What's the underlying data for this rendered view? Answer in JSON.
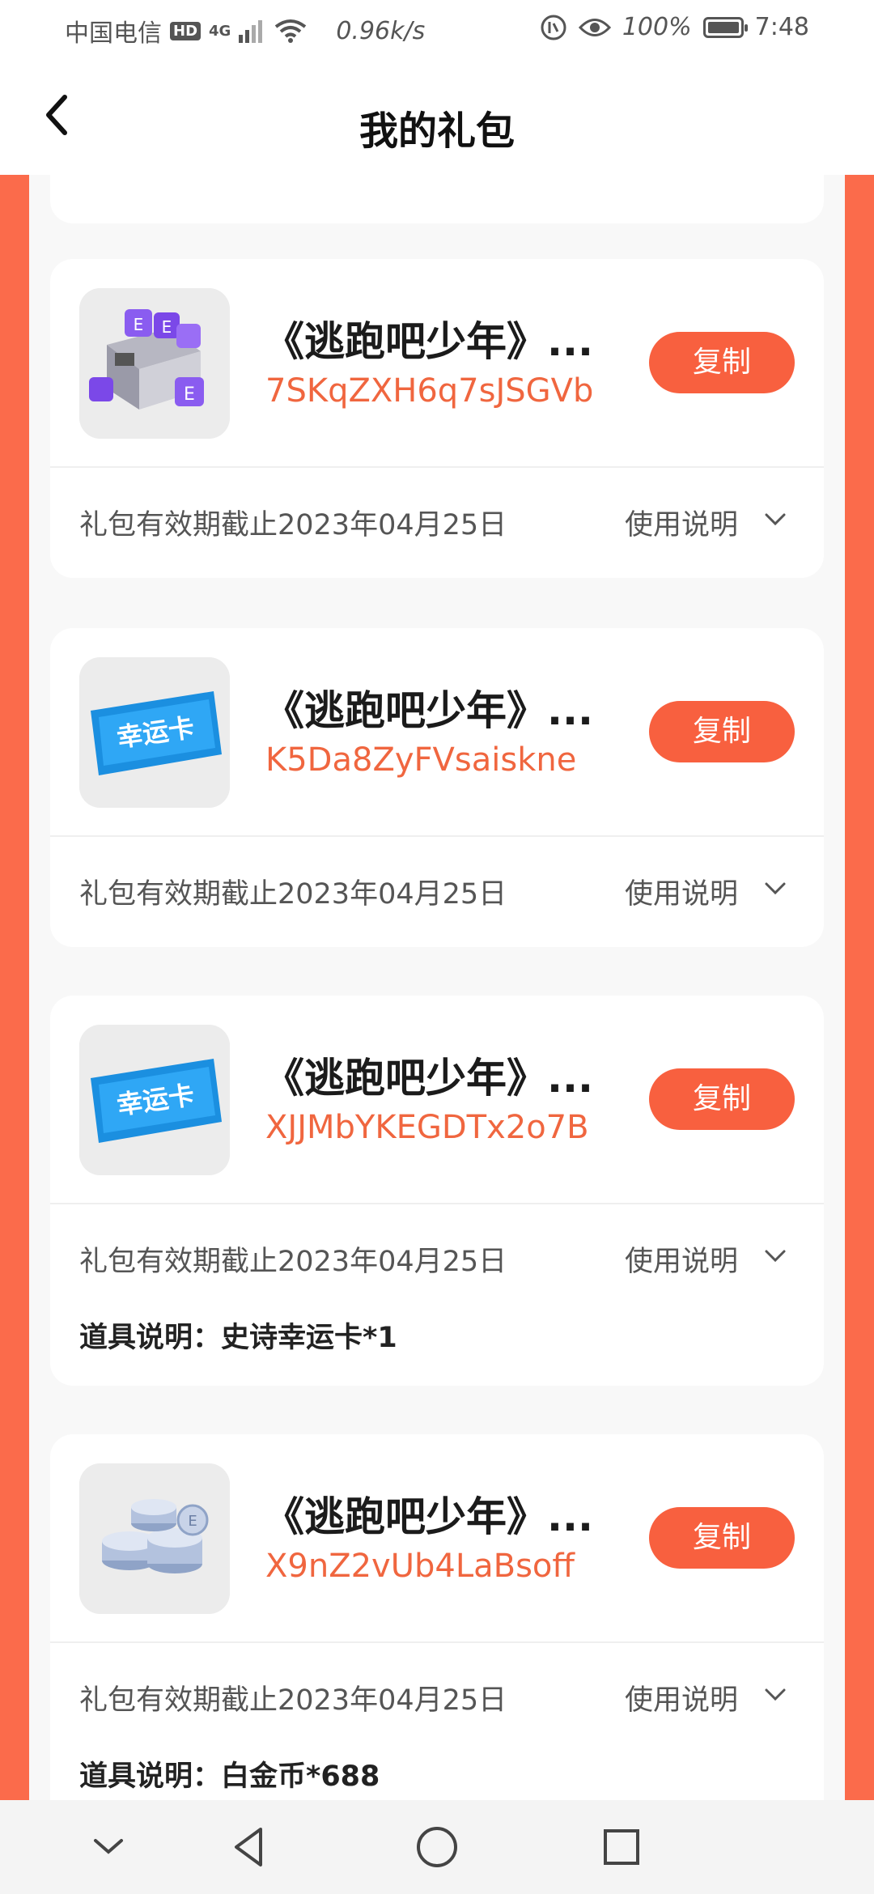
{
  "status_bar": {
    "carrier": "中国电信",
    "hd": "HD",
    "network": "4G",
    "speed": "0.96k/s",
    "battery": "100%",
    "time": "7:48"
  },
  "header": {
    "title": "我的礼包"
  },
  "gifts": [
    {
      "title": "《逃跑吧少年》...",
      "code": "7SKqZXH6q7sJSGVb",
      "copy_label": "复制",
      "expire": "礼包有效期截止2023年04月25日",
      "usage_label": "使用说明",
      "icon": "purple-chest-icon"
    },
    {
      "title": "《逃跑吧少年》...",
      "code": "K5Da8ZyFVsaiskne",
      "copy_label": "复制",
      "expire": "礼包有效期截止2023年04月25日",
      "usage_label": "使用说明",
      "icon": "lucky-card-icon",
      "icon_text": "幸运卡"
    },
    {
      "title": "《逃跑吧少年》...",
      "code": "XJJMbYKEGDTx2o7B",
      "copy_label": "复制",
      "expire": "礼包有效期截止2023年04月25日",
      "usage_label": "使用说明",
      "icon": "lucky-card-icon",
      "icon_text": "幸运卡",
      "prop_label": "道具说明：",
      "prop_value": "史诗幸运卡*1"
    },
    {
      "title": "《逃跑吧少年》...",
      "code": "X9nZ2vUb4LaBsoff",
      "copy_label": "复制",
      "expire": "礼包有效期截止2023年04月25日",
      "usage_label": "使用说明",
      "icon": "platinum-coins-icon",
      "prop_label": "道具说明：",
      "prop_value": "白金币*688"
    }
  ],
  "colors": {
    "accent": "#f8603f",
    "code": "#f0663f",
    "frame": "#fb6b4b"
  }
}
